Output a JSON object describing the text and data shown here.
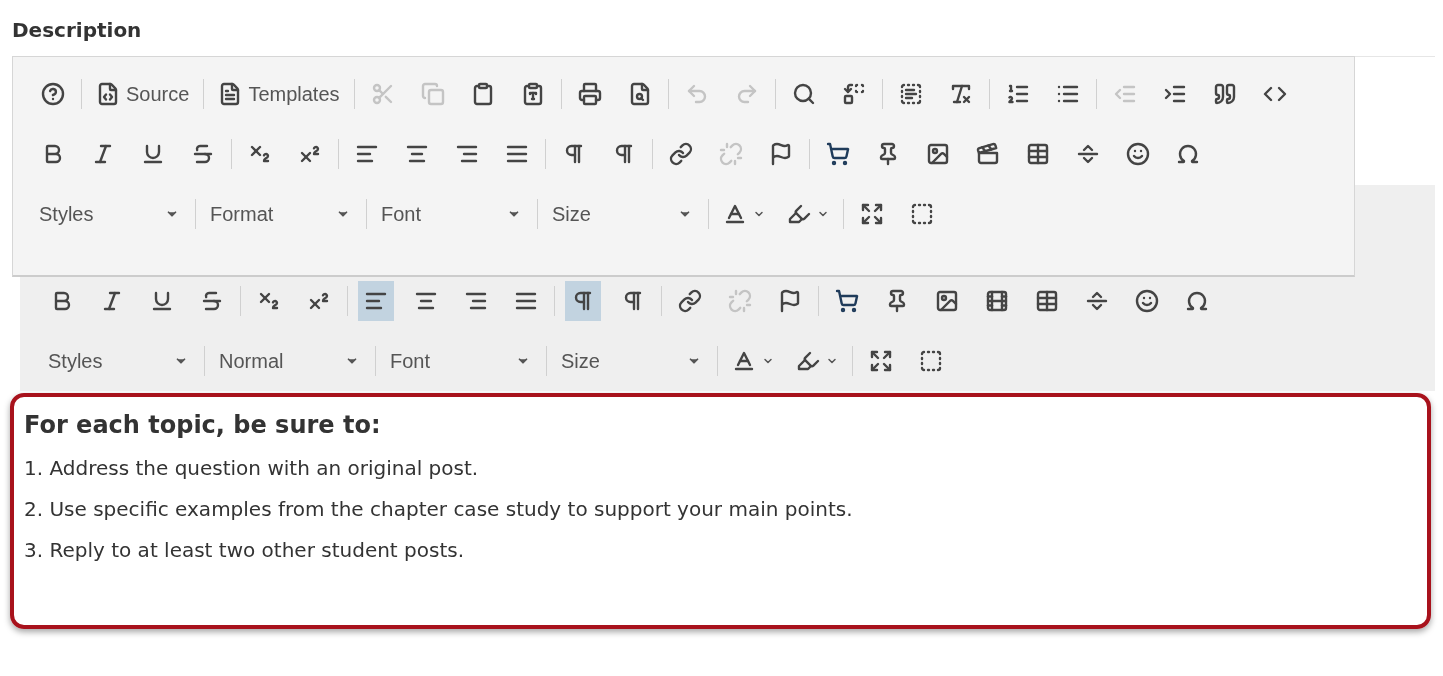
{
  "field_label": "Description",
  "overlay_toolbar": {
    "rows": [
      [
        [
          {
            "kind": "help",
            "disabled": false
          }
        ],
        [
          {
            "kind": "source",
            "label": "Source",
            "disabled": false
          }
        ],
        [
          {
            "kind": "templates",
            "label": "Templates",
            "disabled": false
          }
        ],
        [
          {
            "kind": "cut",
            "disabled": true
          },
          {
            "kind": "copy",
            "disabled": true
          },
          {
            "kind": "paste",
            "disabled": false
          },
          {
            "kind": "pastetext",
            "disabled": false
          }
        ],
        [
          {
            "kind": "print",
            "disabled": false
          },
          {
            "kind": "preview",
            "disabled": false
          }
        ],
        [
          {
            "kind": "undo",
            "disabled": true
          },
          {
            "kind": "redo",
            "disabled": true
          }
        ],
        [
          {
            "kind": "find",
            "disabled": false
          },
          {
            "kind": "replace",
            "disabled": false
          }
        ],
        [
          {
            "kind": "selectall",
            "disabled": false
          },
          {
            "kind": "removeformat",
            "disabled": false
          }
        ],
        [
          {
            "kind": "ol",
            "disabled": false
          },
          {
            "kind": "ul",
            "disabled": false
          }
        ],
        [
          {
            "kind": "outdent",
            "disabled": true
          },
          {
            "kind": "indent",
            "disabled": false
          },
          {
            "kind": "quote",
            "disabled": false
          },
          {
            "kind": "div",
            "disabled": false
          }
        ]
      ],
      [
        [
          {
            "kind": "bold",
            "disabled": false
          },
          {
            "kind": "italic",
            "disabled": false
          },
          {
            "kind": "underline",
            "disabled": false
          },
          {
            "kind": "strike",
            "disabled": false
          }
        ],
        [
          {
            "kind": "sub",
            "disabled": false
          },
          {
            "kind": "sup",
            "disabled": false
          }
        ],
        [
          {
            "kind": "alignleft",
            "disabled": false
          },
          {
            "kind": "aligncenter",
            "disabled": false
          },
          {
            "kind": "alignright",
            "disabled": false
          },
          {
            "kind": "justify",
            "disabled": false
          }
        ],
        [
          {
            "kind": "ltr",
            "disabled": false
          },
          {
            "kind": "rtl",
            "disabled": false
          }
        ],
        [
          {
            "kind": "link",
            "disabled": false
          },
          {
            "kind": "unlink",
            "disabled": true
          },
          {
            "kind": "anchor",
            "disabled": false
          }
        ],
        [
          {
            "kind": "cart",
            "disabled": false
          },
          {
            "kind": "pin",
            "disabled": false
          },
          {
            "kind": "image",
            "disabled": false
          },
          {
            "kind": "media",
            "disabled": false
          },
          {
            "kind": "table",
            "disabled": false
          },
          {
            "kind": "hr",
            "disabled": false
          },
          {
            "kind": "smiley",
            "disabled": false
          },
          {
            "kind": "omega",
            "disabled": false
          }
        ]
      ],
      [
        [
          {
            "kind": "dropdown",
            "label": "Styles"
          }
        ],
        [
          {
            "kind": "dropdown",
            "label": "Format"
          }
        ],
        [
          {
            "kind": "dropdown",
            "label": "Font"
          }
        ],
        [
          {
            "kind": "dropdown",
            "label": "Size"
          }
        ],
        [
          {
            "kind": "textcolor"
          },
          {
            "kind": "bgcolor"
          }
        ],
        [
          {
            "kind": "maximize"
          },
          {
            "kind": "showblocks"
          }
        ]
      ]
    ]
  },
  "editor_toolbar": {
    "rows": [
      [
        [
          {
            "kind": "bold",
            "active": false,
            "disabled": false
          },
          {
            "kind": "italic",
            "active": false,
            "disabled": false
          },
          {
            "kind": "underline",
            "active": false,
            "disabled": false
          },
          {
            "kind": "strike",
            "active": false,
            "disabled": false
          }
        ],
        [
          {
            "kind": "sub",
            "active": false,
            "disabled": false
          },
          {
            "kind": "sup",
            "active": false,
            "disabled": false
          }
        ],
        [
          {
            "kind": "alignleft",
            "active": true,
            "disabled": false
          },
          {
            "kind": "aligncenter",
            "active": false,
            "disabled": false
          },
          {
            "kind": "alignright",
            "active": false,
            "disabled": false
          },
          {
            "kind": "justify",
            "active": false,
            "disabled": false
          }
        ],
        [
          {
            "kind": "ltr",
            "active": true,
            "disabled": false
          },
          {
            "kind": "rtl",
            "active": false,
            "disabled": false
          }
        ],
        [
          {
            "kind": "link",
            "active": false,
            "disabled": false
          },
          {
            "kind": "unlink",
            "active": false,
            "disabled": true
          },
          {
            "kind": "anchor",
            "active": false,
            "disabled": false
          }
        ],
        [
          {
            "kind": "cart",
            "active": false,
            "disabled": false
          },
          {
            "kind": "pin",
            "active": false,
            "disabled": false
          },
          {
            "kind": "image",
            "active": false,
            "disabled": false
          },
          {
            "kind": "film",
            "active": false,
            "disabled": false
          },
          {
            "kind": "table",
            "active": false,
            "disabled": false
          },
          {
            "kind": "hr",
            "active": false,
            "disabled": false
          },
          {
            "kind": "smiley",
            "active": false,
            "disabled": false
          },
          {
            "kind": "omega",
            "active": false,
            "disabled": false
          }
        ]
      ],
      [
        [
          {
            "kind": "dropdown",
            "label": "Styles"
          }
        ],
        [
          {
            "kind": "dropdown",
            "label": "Normal"
          }
        ],
        [
          {
            "kind": "dropdown",
            "label": "Font"
          }
        ],
        [
          {
            "kind": "dropdown",
            "label": "Size"
          }
        ],
        [
          {
            "kind": "textcolor"
          },
          {
            "kind": "bgcolor"
          }
        ],
        [
          {
            "kind": "maximize"
          },
          {
            "kind": "showblocks"
          }
        ]
      ]
    ]
  },
  "content": {
    "heading": "For each topic, be sure to:",
    "paragraphs": [
      "1. Address the question with an original post.",
      "2. Use specific examples from the chapter case study to support your main points.",
      "3. Reply to at least two other student posts."
    ]
  }
}
